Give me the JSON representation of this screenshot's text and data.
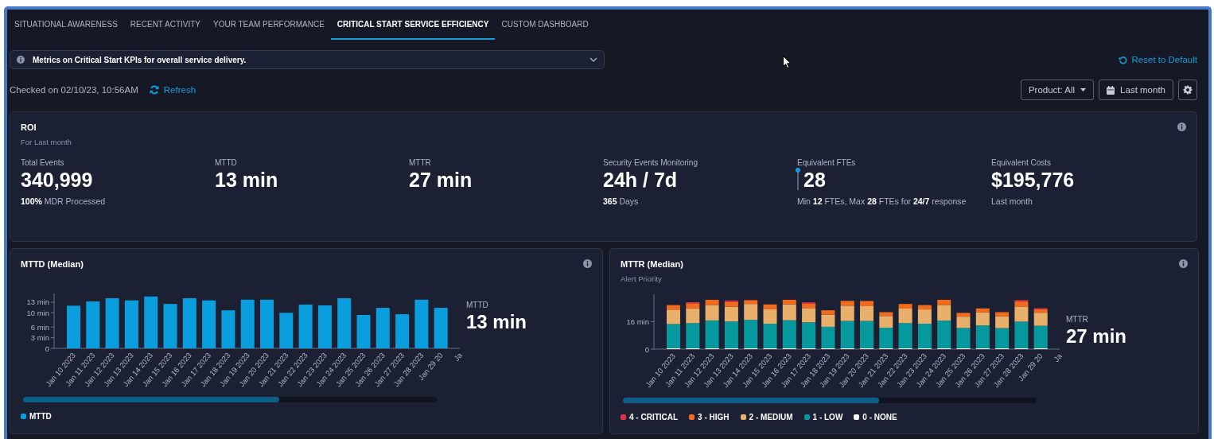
{
  "tabs": [
    {
      "label": "SITUATIONAL AWARENESS",
      "selected": false
    },
    {
      "label": "RECENT ACTIVITY",
      "selected": false
    },
    {
      "label": "YOUR TEAM PERFORMANCE",
      "selected": false
    },
    {
      "label": "CRITICAL START SERVICE EFFICIENCY",
      "selected": true
    },
    {
      "label": "CUSTOM DASHBOARD",
      "selected": false
    }
  ],
  "info_banner": {
    "text": "Metrics on Critical Start KPIs for overall service delivery."
  },
  "reset_link": "Reset to Default",
  "checked_on": "Checked on 02/10/23, 10:56AM",
  "refresh_link": "Refresh",
  "filters": {
    "product": "Product: All",
    "period": "Last month"
  },
  "roi": {
    "title": "ROI",
    "subtitle": "For Last month",
    "metrics": [
      {
        "kind": "plain",
        "label": "Total Events",
        "value": "340,999",
        "note": "**100%** MDR Processed"
      },
      {
        "kind": "plain",
        "label": "MTTD",
        "value": "13 min"
      },
      {
        "kind": "plain",
        "label": "MTTR",
        "value": "27 min"
      },
      {
        "kind": "plain",
        "label": "Security Events Monitoring",
        "value": "24h / 7d",
        "note": "**365** Days"
      },
      {
        "kind": "gauge",
        "label": "Equivalent FTEs",
        "value": "28",
        "level": 1,
        "note": "Min **12** FTEs, Max **28** FTEs for **24/7** response"
      },
      {
        "kind": "plain",
        "label": "Equivalent Costs",
        "value": "$195,776",
        "note": "Last month"
      }
    ]
  },
  "panels": [
    {
      "title": "MTTD (Median)",
      "summary": {
        "label": "MTTD",
        "value": "13 min"
      },
      "chart_data": {
        "type": "bar",
        "categories": [
          "Jan 10 2023",
          "Jan 11 2023",
          "Jan 12 2023",
          "Jan 13 2023",
          "Jan 14 2023",
          "Jan 15 2023",
          "Jan 16 2023",
          "Jan 17 2023",
          "Jan 18 2023",
          "Jan 19 2023",
          "Jan 20 2023",
          "Jan 21 2023",
          "Jan 22 2023",
          "Jan 23 2023",
          "Jan 24 2023",
          "Jan 25 2023",
          "Jan 26 2023",
          "Jan 27 2023",
          "Jan 28 2023",
          "Jan 29 20",
          "Ja"
        ],
        "series": [
          {
            "name": "MTTD",
            "color": "#0a9ede",
            "values": [
              12,
              13.2,
              14.1,
              13.5,
              14.6,
              12.5,
              14.1,
              13.5,
              10.7,
              13.7,
              13.7,
              10,
              12.3,
              12.1,
              14.1,
              9.4,
              11.4,
              9.6,
              13.7,
              11.4,
              null
            ]
          }
        ],
        "ylim": [
          0,
          15
        ],
        "yticks": [
          {
            "value": 0,
            "label": "0"
          },
          {
            "value": 3,
            "label": "3 min"
          },
          {
            "value": 6,
            "label": "6 min"
          },
          {
            "value": 10,
            "label": "10 min"
          },
          {
            "value": 13,
            "label": "13 min"
          }
        ]
      }
    },
    {
      "title": "MTTR (Median)",
      "subtitle": "Alert Priority",
      "summary": {
        "label": "MTTR",
        "value": "27 min"
      },
      "chart_data": {
        "type": "bar",
        "stacked": true,
        "categories": [
          "Jan 10 2023",
          "Jan 11 2023",
          "Jan 12 2023",
          "Jan 13 2023",
          "Jan 14 2023",
          "Jan 15 2023",
          "Jan 16 2023",
          "Jan 17 2023",
          "Jan 18 2023",
          "Jan 19 2023",
          "Jan 20 2023",
          "Jan 21 2023",
          "Jan 22 2023",
          "Jan 23 2023",
          "Jan 24 2023",
          "Jan 25 2023",
          "Jan 26 2023",
          "Jan 27 2023",
          "Jan 28 2023",
          "Jan 29 20",
          "Ja"
        ],
        "series": [
          {
            "name": "0 - NONE",
            "color": "#ffffff",
            "values": [
              0.5,
              0.5,
              0.5,
              0.5,
              0.5,
              0.5,
              0.5,
              0.5,
              0.5,
              0.5,
              0.5,
              0.5,
              0.5,
              0.5,
              0.5,
              0.5,
              0.5,
              0.5,
              0.5,
              0.5,
              null
            ]
          },
          {
            "name": "1 - LOW",
            "color": "#05999e",
            "values": [
              14.1,
              14.6,
              16.2,
              15.6,
              16.5,
              14.3,
              16.3,
              15.1,
              12.5,
              15.9,
              15.9,
              12,
              14.6,
              14.3,
              16.1,
              11.8,
              13.3,
              11.7,
              15.5,
              13.1,
              null
            ]
          },
          {
            "name": "2 - MEDIUM",
            "color": "#e8b06a",
            "values": [
              8.4,
              8.6,
              9,
              8.6,
              9.3,
              8.4,
              9.3,
              8.3,
              7.1,
              8.9,
              8.6,
              6.8,
              8.5,
              8.3,
              9.1,
              6.6,
              7.6,
              7,
              8.8,
              7.6,
              null
            ]
          },
          {
            "name": "3 - HIGH",
            "color": "#f26a1b",
            "values": [
              2.6,
              3,
              3,
              2.8,
              2.2,
              2.8,
              2.6,
              2.5,
              2.5,
              2.8,
              3,
              2.2,
              2.7,
              2.5,
              3,
              2.2,
              2.3,
              2.3,
              2.9,
              2,
              null
            ]
          },
          {
            "name": "4 - CRITICAL",
            "color": "#e0314b",
            "values": [
              0,
              0.6,
              0,
              0.8,
              0,
              0,
              0,
              0.8,
              0,
              0,
              0,
              0,
              0,
              0,
              0,
              0,
              0,
              0,
              0.8,
              0.6,
              null
            ]
          }
        ],
        "ylim": [
          0,
          31
        ],
        "yticks": [
          {
            "value": 0,
            "label": "0"
          },
          {
            "value": 16,
            "label": "16 min"
          }
        ]
      }
    }
  ]
}
